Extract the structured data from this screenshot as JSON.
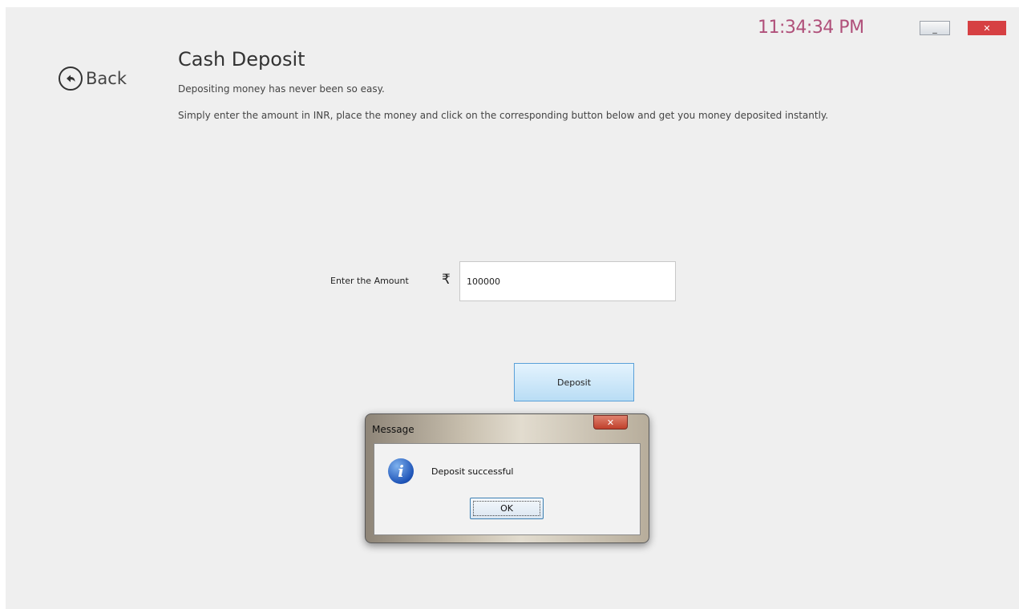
{
  "header": {
    "clock": "11:34:34 PM",
    "minimize_icon": "minimize-icon",
    "close_icon": "close-icon",
    "close_label": "✕",
    "minimize_label": "_"
  },
  "nav": {
    "back_label": "Back",
    "back_icon": "back-arrow-icon"
  },
  "page": {
    "title": "Cash Deposit",
    "subtitle": "Depositing money has never been so easy.",
    "description": "Simply enter the amount in INR, place the money and click on the corresponding button below and get you money deposited instantly."
  },
  "form": {
    "amount_label": "Enter the Amount",
    "currency_symbol": "₹",
    "amount_value": "100000",
    "deposit_label": "Deposit"
  },
  "dialog": {
    "title": "Message",
    "close_label": "✕",
    "icon": "info-icon",
    "icon_glyph": "i",
    "message": "Deposit successful",
    "ok_label": "OK"
  },
  "colors": {
    "clock": "#b0507a",
    "window_close": "#d64043",
    "deposit_button": "#b9ddf5"
  }
}
